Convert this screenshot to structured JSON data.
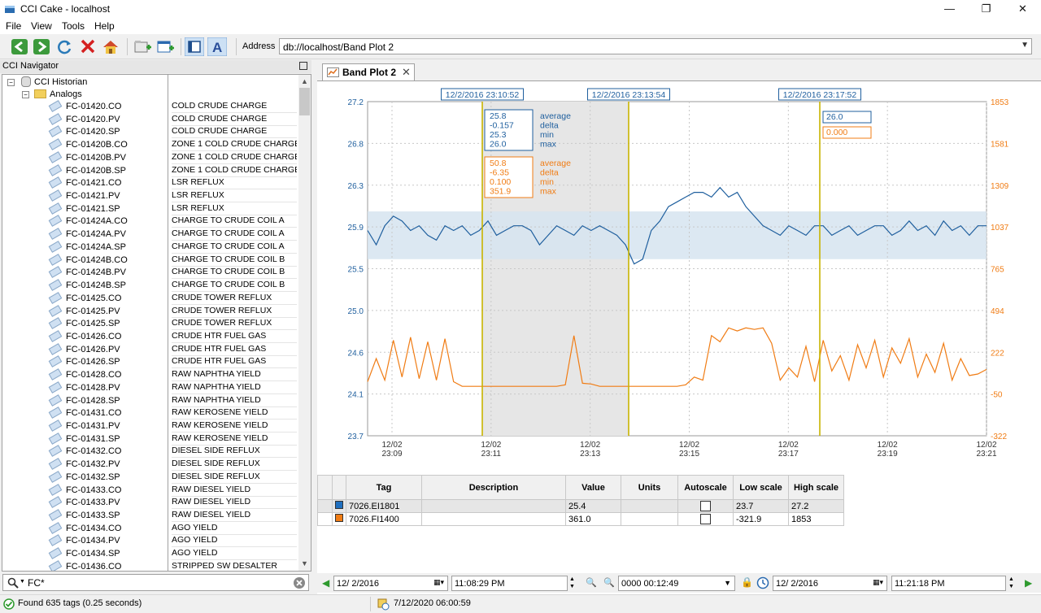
{
  "window": {
    "title": "CCI Cake - localhost",
    "minimize": "—",
    "maximize": "❐",
    "close": "✕"
  },
  "menu": [
    "File",
    "View",
    "Tools",
    "Help"
  ],
  "toolbar": {
    "address_label": "Address",
    "address_value": "db://localhost/Band Plot 2"
  },
  "navigator": {
    "title": "CCI Navigator",
    "root": "CCI Historian",
    "folder": "Analogs",
    "tags": [
      {
        "name": "FC-01420.CO",
        "desc": "COLD CRUDE CHARGE"
      },
      {
        "name": "FC-01420.PV",
        "desc": "COLD CRUDE CHARGE"
      },
      {
        "name": "FC-01420.SP",
        "desc": "COLD CRUDE CHARGE"
      },
      {
        "name": "FC-01420B.CO",
        "desc": "ZONE 1 COLD CRUDE CHARGE"
      },
      {
        "name": "FC-01420B.PV",
        "desc": "ZONE 1 COLD CRUDE CHARGE"
      },
      {
        "name": "FC-01420B.SP",
        "desc": "ZONE 1 COLD CRUDE CHARGE"
      },
      {
        "name": "FC-01421.CO",
        "desc": "LSR REFLUX"
      },
      {
        "name": "FC-01421.PV",
        "desc": "LSR REFLUX"
      },
      {
        "name": "FC-01421.SP",
        "desc": "LSR REFLUX"
      },
      {
        "name": "FC-01424A.CO",
        "desc": "CHARGE TO CRUDE COIL A"
      },
      {
        "name": "FC-01424A.PV",
        "desc": "CHARGE TO CRUDE COIL A"
      },
      {
        "name": "FC-01424A.SP",
        "desc": "CHARGE TO CRUDE COIL A"
      },
      {
        "name": "FC-01424B.CO",
        "desc": "CHARGE TO CRUDE COIL B"
      },
      {
        "name": "FC-01424B.PV",
        "desc": "CHARGE TO CRUDE COIL B"
      },
      {
        "name": "FC-01424B.SP",
        "desc": "CHARGE TO CRUDE COIL B"
      },
      {
        "name": "FC-01425.CO",
        "desc": "CRUDE TOWER REFLUX"
      },
      {
        "name": "FC-01425.PV",
        "desc": "CRUDE TOWER REFLUX"
      },
      {
        "name": "FC-01425.SP",
        "desc": "CRUDE TOWER REFLUX"
      },
      {
        "name": "FC-01426.CO",
        "desc": "CRUDE HTR FUEL GAS"
      },
      {
        "name": "FC-01426.PV",
        "desc": "CRUDE HTR FUEL GAS"
      },
      {
        "name": "FC-01426.SP",
        "desc": "CRUDE HTR FUEL GAS"
      },
      {
        "name": "FC-01428.CO",
        "desc": "RAW NAPHTHA YIELD"
      },
      {
        "name": "FC-01428.PV",
        "desc": "RAW NAPHTHA YIELD"
      },
      {
        "name": "FC-01428.SP",
        "desc": "RAW NAPHTHA YIELD"
      },
      {
        "name": "FC-01431.CO",
        "desc": "RAW KEROSENE YIELD"
      },
      {
        "name": "FC-01431.PV",
        "desc": "RAW KEROSENE YIELD"
      },
      {
        "name": "FC-01431.SP",
        "desc": "RAW KEROSENE YIELD"
      },
      {
        "name": "FC-01432.CO",
        "desc": "DIESEL SIDE REFLUX"
      },
      {
        "name": "FC-01432.PV",
        "desc": "DIESEL SIDE REFLUX"
      },
      {
        "name": "FC-01432.SP",
        "desc": "DIESEL SIDE REFLUX"
      },
      {
        "name": "FC-01433.CO",
        "desc": "RAW DIESEL YIELD"
      },
      {
        "name": "FC-01433.PV",
        "desc": "RAW DIESEL YIELD"
      },
      {
        "name": "FC-01433.SP",
        "desc": "RAW DIESEL YIELD"
      },
      {
        "name": "FC-01434.CO",
        "desc": "AGO YIELD"
      },
      {
        "name": "FC-01434.PV",
        "desc": "AGO YIELD"
      },
      {
        "name": "FC-01434.SP",
        "desc": "AGO YIELD"
      },
      {
        "name": "FC-01436.CO",
        "desc": "STRIPPED SW DESALTER"
      }
    ],
    "search_value": "FC*"
  },
  "status": {
    "found": "Found 635 tags (0.25 seconds)",
    "datetime": "7/12/2020 06:00:59"
  },
  "tab": {
    "label": "Band Plot 2",
    "close": "✕"
  },
  "chart": {
    "cursors": [
      "12/2/2016 23:10:52",
      "12/2/2016 23:13:54",
      "12/2/2016 23:17:52"
    ],
    "left_ticks": [
      "27.2",
      "26.8",
      "26.3",
      "25.9",
      "25.5",
      "25.0",
      "24.6",
      "24.1",
      "23.7"
    ],
    "right_ticks": [
      "1853",
      "1581",
      "1309",
      "1037",
      "765",
      "494",
      "222",
      "-50",
      "-322"
    ],
    "x_ticks": [
      {
        "date": "12/02",
        "time": "23:09"
      },
      {
        "date": "12/02",
        "time": "23:11"
      },
      {
        "date": "12/02",
        "time": "23:13"
      },
      {
        "date": "12/02",
        "time": "23:15"
      },
      {
        "date": "12/02",
        "time": "23:17"
      },
      {
        "date": "12/02",
        "time": "23:19"
      },
      {
        "date": "12/02",
        "time": "23:21"
      }
    ],
    "stats_labels": [
      "average",
      "delta",
      "min",
      "max"
    ],
    "blue_stats": [
      "25.8",
      "-0.157",
      "25.3",
      "26.0"
    ],
    "orange_stats": [
      "50.8",
      "-6.35",
      "0.100",
      "351.9"
    ],
    "blue_cursor_value": "26.0",
    "orange_cursor_value": "0.000",
    "colors": {
      "blue": "#1f5f9e",
      "orange": "#f07c14",
      "cursor": "#c8b400",
      "band": "#d6e4f0",
      "shade": "#e6e6e6"
    }
  },
  "chart_data": {
    "type": "line",
    "xlim": [
      "23:09",
      "23:21"
    ],
    "ylim_left": [
      23.7,
      27.2
    ],
    "ylim_right": [
      -322,
      1853
    ],
    "band": [
      25.55,
      26.05
    ],
    "series": [
      {
        "name": "7026.EI1801",
        "axis": "left",
        "color": "#1f5f9e",
        "values": [
          25.85,
          25.7,
          25.9,
          26.0,
          25.95,
          25.85,
          25.9,
          25.8,
          25.75,
          25.9,
          25.85,
          25.9,
          25.8,
          25.85,
          25.95,
          25.8,
          25.85,
          25.9,
          25.9,
          25.85,
          25.7,
          25.8,
          25.9,
          25.85,
          25.8,
          25.9,
          25.85,
          25.9,
          25.85,
          25.8,
          25.7,
          25.5,
          25.55,
          25.85,
          25.95,
          26.1,
          26.15,
          26.2,
          26.25,
          26.25,
          26.2,
          26.3,
          26.2,
          26.25,
          26.1,
          26.0,
          25.9,
          25.85,
          25.8,
          25.9,
          25.85,
          25.8,
          25.9,
          25.9,
          25.8,
          25.85,
          25.9,
          25.8,
          25.85,
          25.9,
          25.9,
          25.8,
          25.85,
          25.95,
          25.85,
          25.9,
          25.8,
          25.95,
          25.85,
          25.9,
          25.8,
          25.9,
          25.9
        ]
      },
      {
        "name": "7026.FI1400",
        "axis": "right",
        "color": "#f07c14",
        "values": [
          30,
          180,
          40,
          300,
          60,
          320,
          50,
          290,
          40,
          310,
          30,
          0,
          0,
          0,
          0,
          0,
          0,
          0,
          0,
          0,
          0,
          0,
          0,
          10,
          330,
          20,
          15,
          0,
          0,
          0,
          0,
          0,
          0,
          0,
          0,
          0,
          0,
          10,
          60,
          40,
          330,
          290,
          380,
          360,
          380,
          370,
          380,
          280,
          40,
          120,
          60,
          260,
          30,
          300,
          100,
          200,
          40,
          270,
          120,
          300,
          60,
          250,
          150,
          310,
          60,
          210,
          90,
          280,
          40,
          180,
          70,
          80,
          110
        ]
      }
    ]
  },
  "grid": {
    "headers": [
      "Tag",
      "Description",
      "Value",
      "Units",
      "Autoscale",
      "Low scale",
      "High scale"
    ],
    "rows": [
      {
        "color": "#1f6fbf",
        "tag": "7026.EI1801",
        "desc": "",
        "value": "25.4",
        "units": "",
        "low": "23.7",
        "high": "27.2"
      },
      {
        "color": "#f07c14",
        "tag": "7026.FI1400",
        "desc": "",
        "value": "361.0",
        "units": "",
        "low": "-321.9",
        "high": "1853"
      }
    ]
  },
  "timebar": {
    "start_date": "12/ 2/2016",
    "start_time": "11:08:29 PM",
    "duration": "0000 00:12:49",
    "end_date": "12/ 2/2016",
    "end_time": "11:21:18 PM"
  }
}
